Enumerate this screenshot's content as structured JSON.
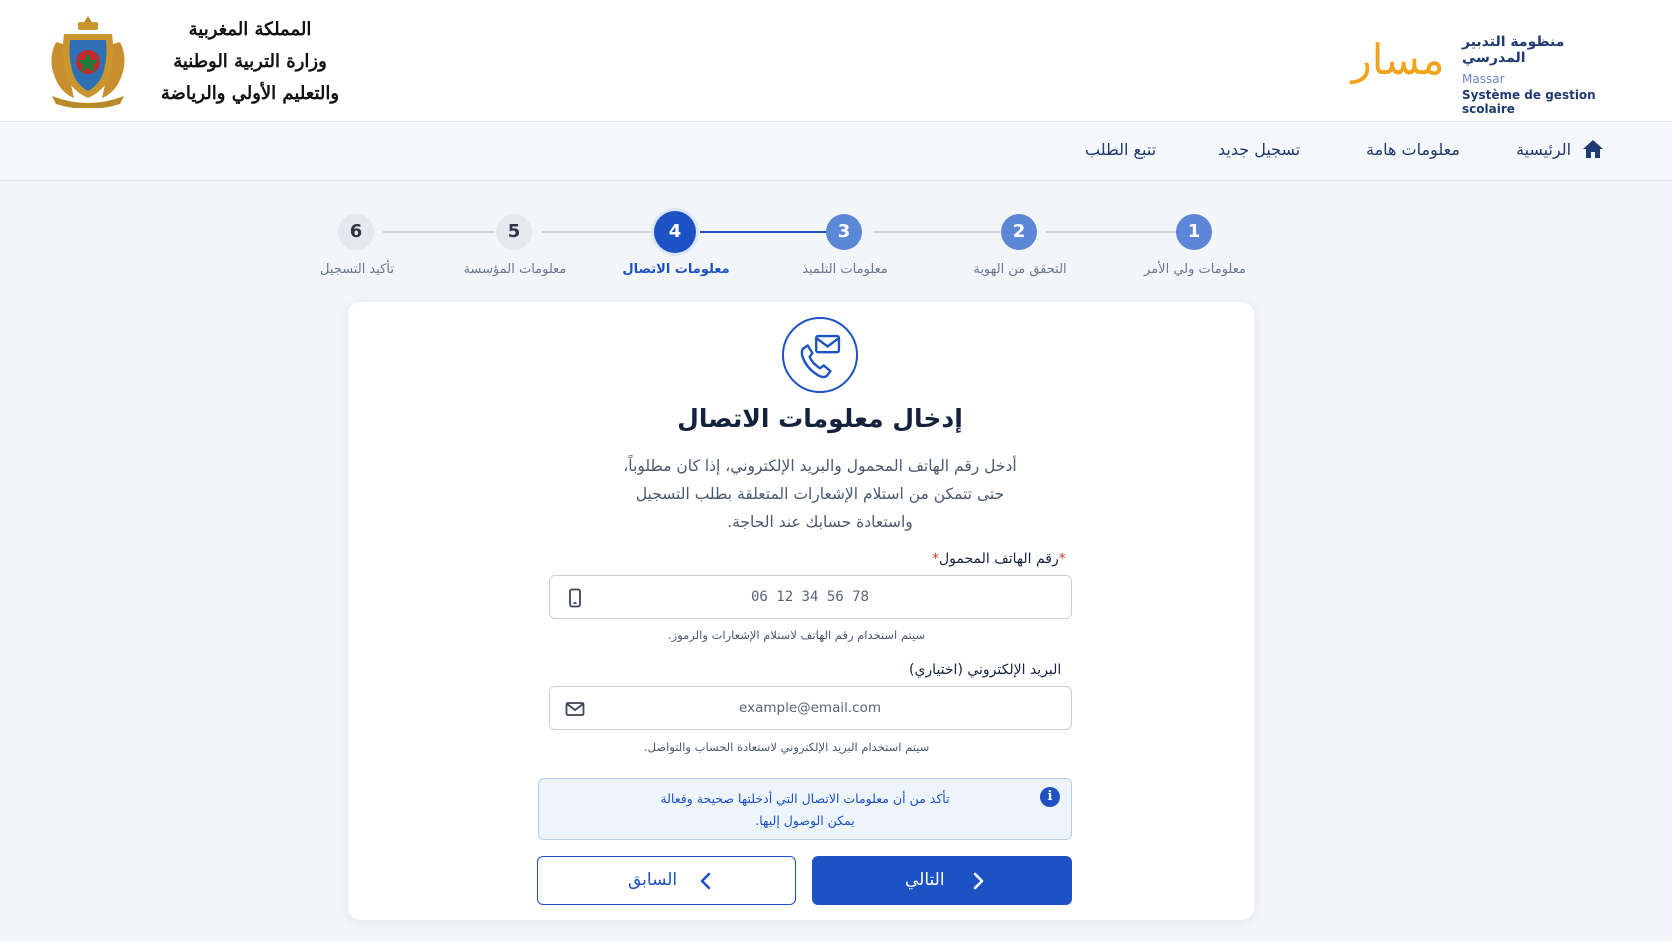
{
  "header": {
    "ministry_lines": [
      "المملكة المغربية",
      "وزارة التربية الوطنية",
      "والتعليم الأولي والرياضة"
    ],
    "massar_logo_text": "مسار",
    "massar_title_ar": "منظومة التدبير المدرسي",
    "massar_name_fr": "Massar",
    "massar_subtitle_fr": "Système de gestion scolaire"
  },
  "nav": {
    "home": "الرئيسية",
    "important_info": "معلومات هامة",
    "new_registration": "تسجيل جديد",
    "track_request": "تتبع الطلب"
  },
  "stepper": {
    "steps": [
      {
        "number": "1",
        "label": "معلومات ولي الأمر",
        "state": "done"
      },
      {
        "number": "2",
        "label": "التحقق من الهوية",
        "state": "done"
      },
      {
        "number": "3",
        "label": "معلومات التلميذ",
        "state": "done"
      },
      {
        "number": "4",
        "label": "معلومات الاتصال",
        "state": "current"
      },
      {
        "number": "5",
        "label": "معلومات المؤسسة",
        "state": "future"
      },
      {
        "number": "6",
        "label": "تأكيد التسجيل",
        "state": "future"
      }
    ]
  },
  "card": {
    "icon": "phone-email-icon",
    "title": "إدخال معلومات الاتصال",
    "description_lines": [
      "أدخل رقم الهاتف المحمول والبريد الإلكتروني، إذا كان مطلوباً،",
      "حتى تتمكن من استلام الإشعارات المتعلقة بطلب التسجيل",
      "واستعادة حسابك عند الحاجة."
    ],
    "phone": {
      "label": "رقم الهاتف المحمول",
      "required_mark": "*",
      "placeholder": "06 12 34 56 78",
      "hint": "سيتم استخدام رقم الهاتف لاستلام الإشعارات والرموز."
    },
    "email": {
      "label": "البريد الإلكتروني (اختياري)",
      "placeholder": "example@email.com",
      "hint": "سيتم استخدام البريد الإلكتروني لاستعادة الحساب والتواصل."
    },
    "info": {
      "lines": [
        "تأكد من أن معلومات الاتصال التي أدخلتها صحيحة وفعالة",
        "يمكن الوصول إليها."
      ]
    },
    "buttons": {
      "previous": "السابق",
      "next": "التالي"
    }
  },
  "colors": {
    "primary": "#1d52c4",
    "step_done": "#5c86d6",
    "massar_orange": "#f2a21b"
  }
}
